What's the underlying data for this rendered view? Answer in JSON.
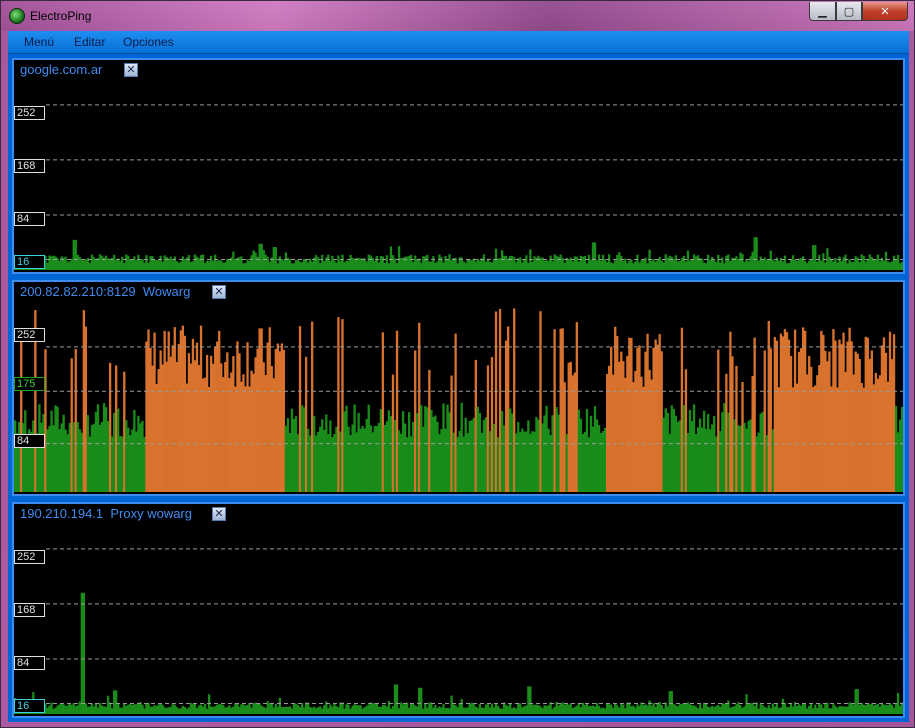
{
  "window": {
    "title": "ElectroPing",
    "icon": "electroping-globe-icon",
    "minimize_glyph": "▁",
    "maximize_glyph": "▢",
    "close_glyph": "✕"
  },
  "menu": {
    "items": [
      "Menú",
      "Editar",
      "Opciones"
    ]
  },
  "colors": {
    "panel_border": "#3f8cf0",
    "bar_normal": "#1a8c1a",
    "bar_high": "#d8722c",
    "grid": "#9a9a9a",
    "menubar": "#0670d6"
  },
  "panels": [
    {
      "label": "google.com.ar",
      "close_glyph": "✕",
      "y_ticks": [
        {
          "label": "252",
          "value": 252,
          "style": "normal"
        },
        {
          "label": "168",
          "value": 168,
          "style": "normal"
        },
        {
          "label": "84",
          "value": 84,
          "style": "normal"
        },
        {
          "label": "16",
          "value": 16,
          "style": "base"
        }
      ],
      "chart_data": {
        "type": "bar",
        "ylim": [
          0,
          290
        ],
        "profile": "low",
        "seed": 11,
        "baseline": 10,
        "spread": 14,
        "spikes": [
          [
            60,
            46
          ],
          [
            245,
            40
          ],
          [
            260,
            35
          ],
          [
            578,
            42
          ],
          [
            740,
            50
          ],
          [
            800,
            38
          ],
          [
            897,
            35
          ]
        ]
      }
    },
    {
      "label": "200.82.82.210:8129  Wowarg",
      "close_glyph": "✕",
      "y_ticks": [
        {
          "label": "252",
          "value": 252,
          "style": "normal"
        },
        {
          "label": "175",
          "value": 175,
          "style": "avg"
        },
        {
          "label": "84",
          "value": 84,
          "style": "normal"
        }
      ],
      "chart_data": {
        "type": "bar",
        "ylim": [
          0,
          330
        ],
        "profile": "high",
        "seed": 7,
        "threshold": 175
      }
    },
    {
      "label": "190.210.194.1  Proxy wowarg",
      "close_glyph": "✕",
      "y_ticks": [
        {
          "label": "252",
          "value": 252,
          "style": "normal"
        },
        {
          "label": "168",
          "value": 168,
          "style": "normal"
        },
        {
          "label": "84",
          "value": 84,
          "style": "normal"
        },
        {
          "label": "16",
          "value": 16,
          "style": "base"
        }
      ],
      "chart_data": {
        "type": "bar",
        "ylim": [
          0,
          290
        ],
        "profile": "low",
        "seed": 23,
        "baseline": 8,
        "spread": 10,
        "spikes": [
          [
            68,
            185
          ],
          [
            100,
            36
          ],
          [
            380,
            45
          ],
          [
            405,
            40
          ],
          [
            515,
            42
          ],
          [
            655,
            35
          ],
          [
            842,
            38
          ]
        ]
      }
    }
  ]
}
